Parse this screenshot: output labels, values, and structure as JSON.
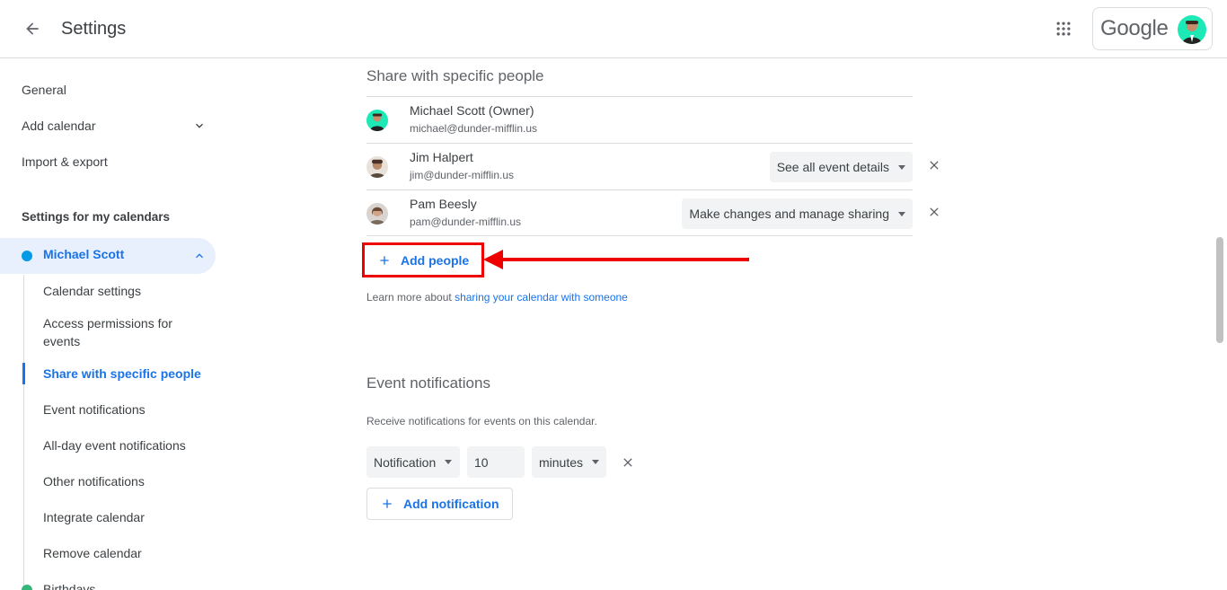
{
  "header": {
    "title": "Settings",
    "logo_text": "Google"
  },
  "sidebar": {
    "general": "General",
    "add_calendar": "Add calendar",
    "import_export": "Import & export",
    "section_title": "Settings for my calendars",
    "calendar_name": "Michael Scott",
    "sub_items": [
      "Calendar settings",
      "Access permissions for events",
      "Share with specific people",
      "Event notifications",
      "All-day event notifications",
      "Other notifications",
      "Integrate calendar",
      "Remove calendar"
    ],
    "next_calendar": "Birthdays"
  },
  "share": {
    "title": "Share with specific people",
    "people": [
      {
        "name": "Michael Scott (Owner)",
        "email": "michael@dunder-mifflin.us",
        "permission": ""
      },
      {
        "name": "Jim Halpert",
        "email": "jim@dunder-mifflin.us",
        "permission": "See all event details"
      },
      {
        "name": "Pam Beesly",
        "email": "pam@dunder-mifflin.us",
        "permission": "Make changes and manage sharing"
      }
    ],
    "add_people": "Add people",
    "learn_more_prefix": "Learn more about ",
    "learn_more_link": "sharing your calendar with someone"
  },
  "notifications": {
    "title": "Event notifications",
    "description": "Receive notifications for events on this calendar.",
    "type": "Notification",
    "amount": "10",
    "unit": "minutes",
    "add_label": "Add notification"
  },
  "colors": {
    "accent": "#1a73e8",
    "annotation": "#ee0000",
    "calendar_dot": "#039be5",
    "birthdays_dot": "#33b679"
  }
}
